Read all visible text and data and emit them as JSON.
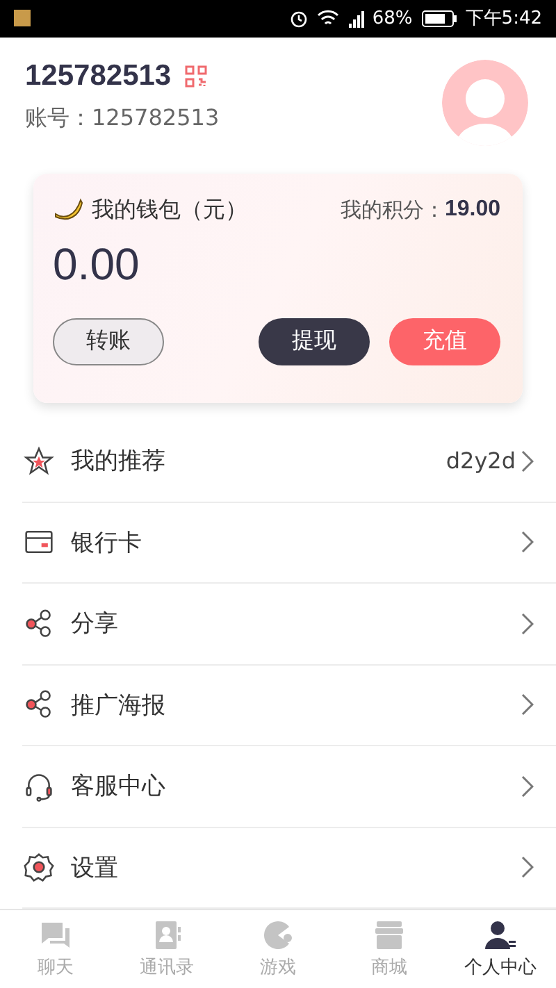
{
  "status_bar": {
    "battery": "68%",
    "time": "下午5:42"
  },
  "profile": {
    "name": "125782513",
    "account": "账号：125782513"
  },
  "wallet": {
    "title": "我的钱包（元）",
    "points_label": "我的积分：",
    "points": "19.00",
    "balance": "0.00",
    "buttons": [
      {
        "label": "转账",
        "kind": "outline"
      },
      {
        "label": "提现",
        "kind": "dark"
      },
      {
        "label": "充值",
        "kind": "primary"
      }
    ]
  },
  "menu": [
    {
      "label": "我的推荐",
      "kind": "star",
      "value": "d2y2d"
    },
    {
      "label": "银行卡",
      "kind": "card"
    },
    {
      "label": "分享",
      "kind": "share"
    },
    {
      "label": "推广海报",
      "kind": "share"
    },
    {
      "label": "客服中心",
      "kind": "headset"
    },
    {
      "label": "设置",
      "kind": "gear"
    }
  ],
  "tabs": [
    {
      "label": "聊天",
      "kind": "chat",
      "selected": false
    },
    {
      "label": "通讯录",
      "kind": "contacts",
      "selected": false
    },
    {
      "label": "游戏",
      "kind": "game",
      "selected": false
    },
    {
      "label": "商城",
      "kind": "shop",
      "selected": false
    },
    {
      "label": "个人中心",
      "kind": "person",
      "selected": true
    }
  ]
}
